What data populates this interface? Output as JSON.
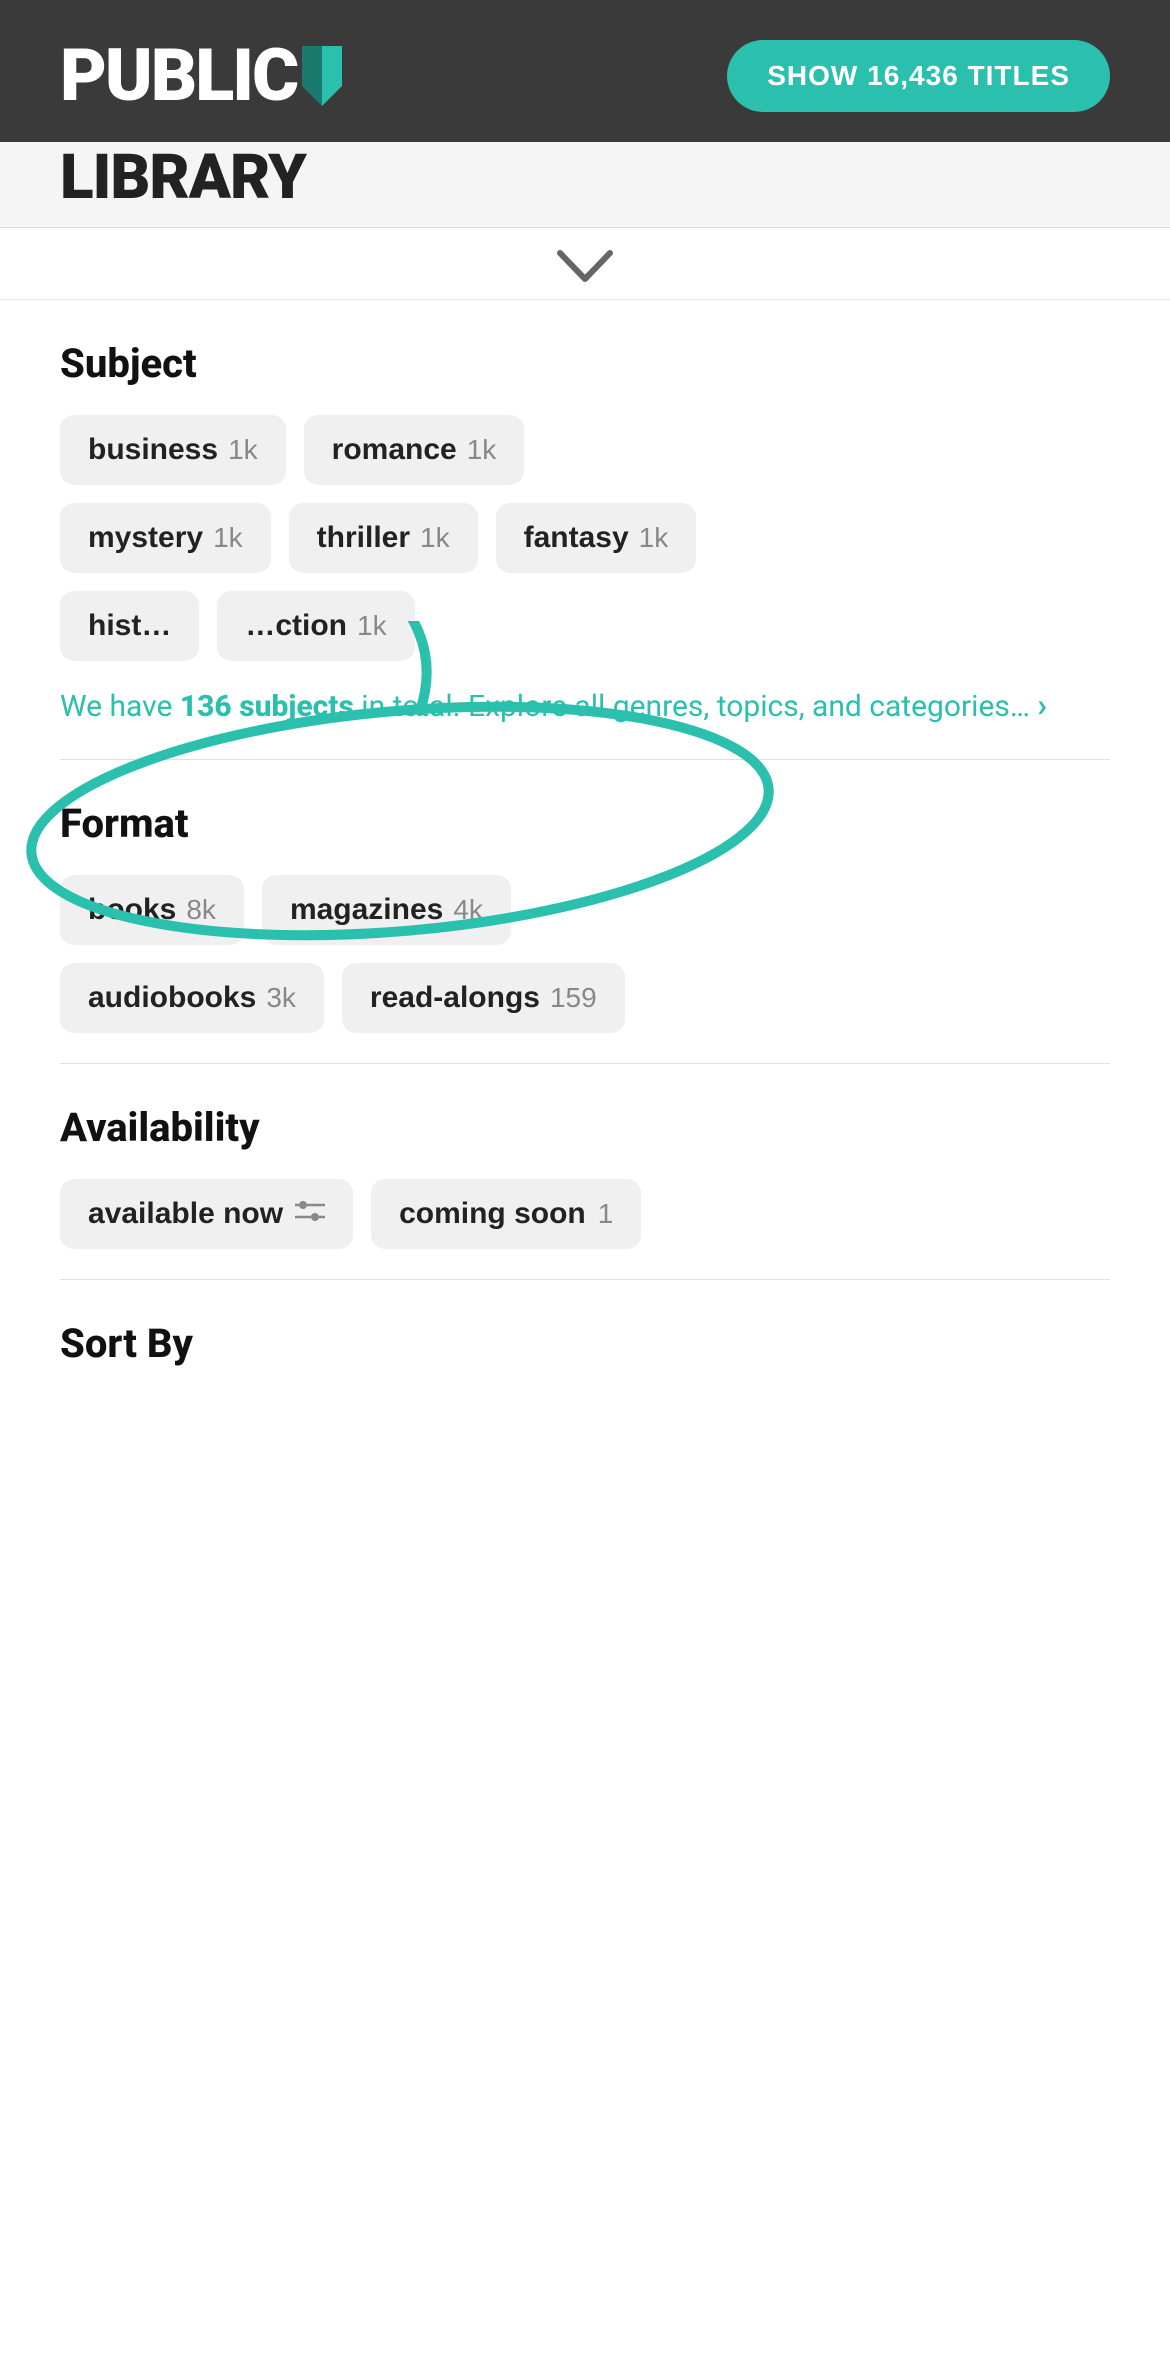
{
  "header": {
    "logo": "PUBLIC",
    "logo_subtitle": "LIBRARY",
    "show_titles_btn": "SHOW 16,436 TITLES",
    "titles_count": "16,436"
  },
  "chevron": "∨",
  "subject_section": {
    "title": "Subject",
    "tags": [
      {
        "label": "business",
        "count": "1k"
      },
      {
        "label": "romance",
        "count": "1k"
      },
      {
        "label": "mystery",
        "count": "1k"
      },
      {
        "label": "thriller",
        "count": "1k"
      },
      {
        "label": "fantasy",
        "count": "1k"
      },
      {
        "label": "hist…",
        "count": ""
      },
      {
        "label": "…ction",
        "count": "1k"
      }
    ],
    "explore_text_pre": "We have ",
    "explore_count": "136 subjects",
    "explore_text_post": " in total. Explore all genres, topics, and categories…",
    "explore_arrow": "›"
  },
  "format_section": {
    "title": "Format",
    "tags": [
      {
        "label": "books",
        "count": "8k"
      },
      {
        "label": "magazines",
        "count": "4k"
      },
      {
        "label": "audiobooks",
        "count": "3k"
      },
      {
        "label": "read-alongs",
        "count": "159"
      }
    ]
  },
  "availability_section": {
    "title": "Availability",
    "options": [
      {
        "label": "available now",
        "count": "",
        "has_filter_icon": true
      },
      {
        "label": "coming soon",
        "count": "1",
        "has_filter_icon": false
      }
    ]
  },
  "sort_section": {
    "title": "Sort By"
  },
  "colors": {
    "teal": "#2bbfad",
    "bg_chip": "#f0f0f0",
    "text_dark": "#111111",
    "text_muted": "#888888"
  }
}
